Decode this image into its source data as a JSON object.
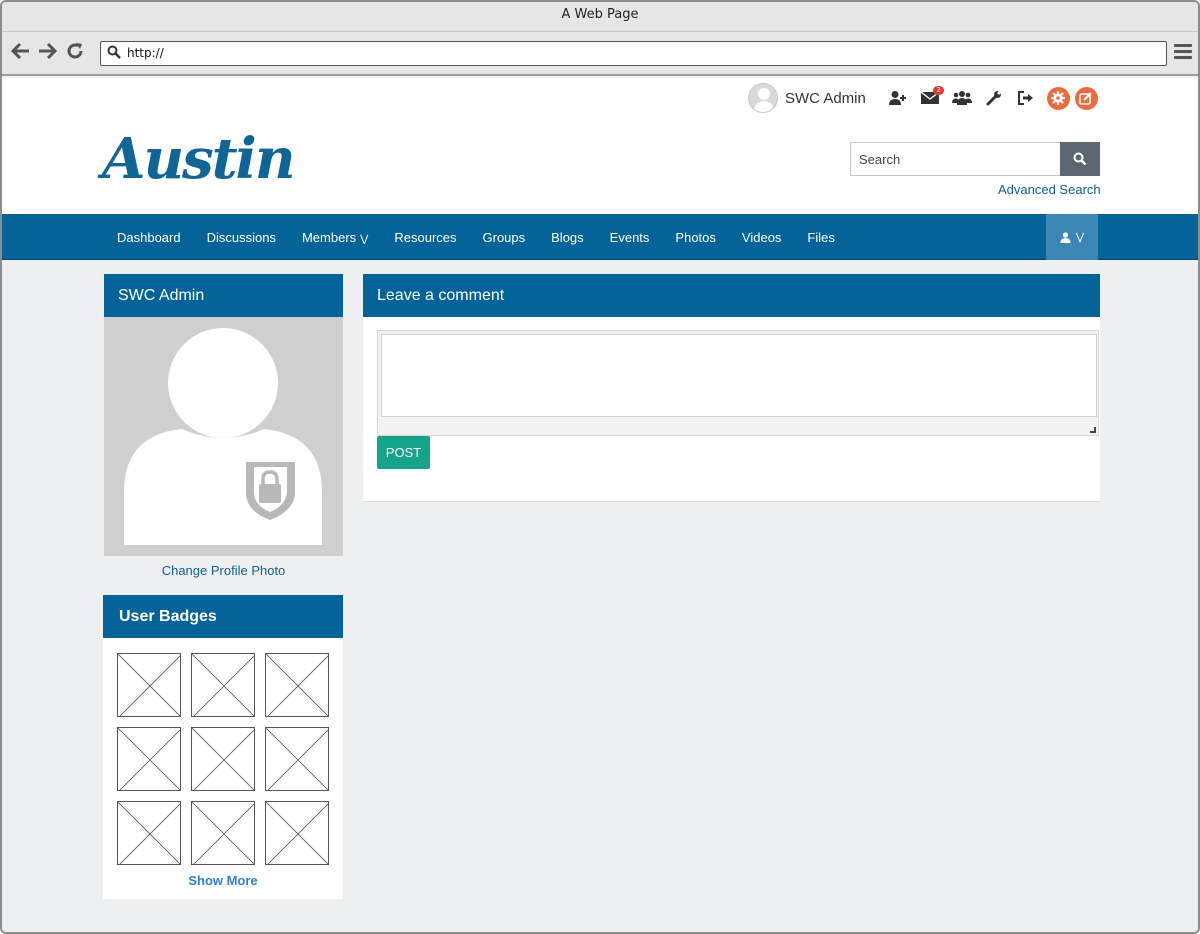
{
  "browser": {
    "title": "A Web Page",
    "url": "http://"
  },
  "userbar": {
    "username": "SWC Admin",
    "message_count": "2"
  },
  "header": {
    "logo": "Austin",
    "search_placeholder": "Search",
    "advanced_search": "Advanced Search"
  },
  "nav": {
    "items": [
      {
        "label": "Dashboard"
      },
      {
        "label": "Discussions"
      },
      {
        "label": "Members"
      },
      {
        "label": "Resources"
      },
      {
        "label": "Groups"
      },
      {
        "label": "Blogs"
      },
      {
        "label": "Events"
      },
      {
        "label": "Photos"
      },
      {
        "label": "Videos"
      },
      {
        "label": "Files"
      }
    ]
  },
  "profile": {
    "name": "SWC Admin",
    "change_photo": "Change Profile Photo"
  },
  "badges": {
    "title": "User Badges",
    "show_more": "Show More"
  },
  "comment": {
    "title": "Leave a comment",
    "post_label": "POST"
  },
  "colors": {
    "brand": "#046398",
    "accent_orange": "#ee6a3c",
    "post_green": "#16a38a"
  },
  "icons": [
    "search-icon",
    "back-arrow-icon",
    "forward-arrow-icon",
    "reload-icon",
    "menu-icon",
    "add-user-icon",
    "envelope-icon",
    "group-icon",
    "wrench-icon",
    "sign-out-icon",
    "gear-icon",
    "edit-icon",
    "user-icon"
  ]
}
